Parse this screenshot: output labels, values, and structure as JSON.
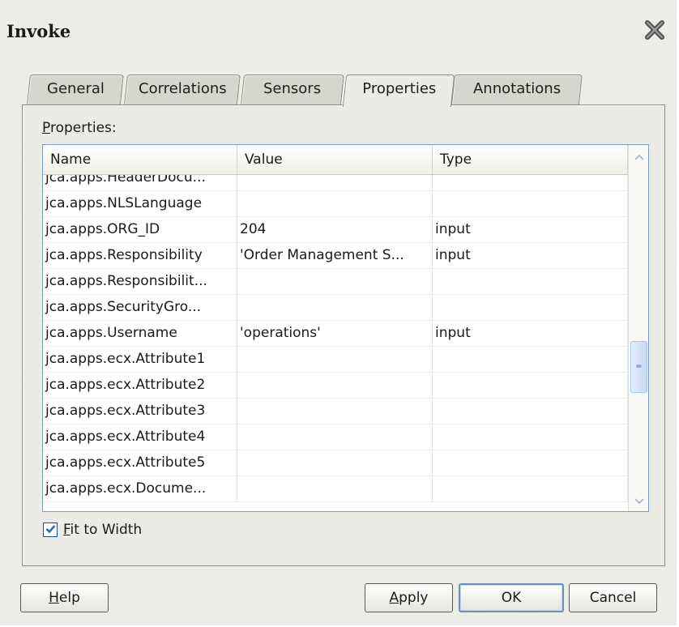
{
  "dialog": {
    "title": "Invoke",
    "close_icon": "close-x-icon"
  },
  "tabs": [
    {
      "label": "General",
      "active": false
    },
    {
      "label": "Correlations",
      "active": false
    },
    {
      "label": "Sensors",
      "active": false
    },
    {
      "label": "Properties",
      "active": true
    },
    {
      "label": "Annotations",
      "active": false
    }
  ],
  "properties": {
    "label_mnemonic": "P",
    "label_rest": "roperties:",
    "columns": [
      "Name",
      "Value",
      "Type"
    ],
    "rows": [
      {
        "name": "jca.apps.HeaderDocu...",
        "value": "",
        "type": ""
      },
      {
        "name": "jca.apps.NLSLanguage",
        "value": "",
        "type": ""
      },
      {
        "name": "jca.apps.ORG_ID",
        "value": "204",
        "type": "input"
      },
      {
        "name": "jca.apps.Responsibility",
        "value": "'Order Management S...",
        "type": "input"
      },
      {
        "name": "jca.apps.Responsibilit...",
        "value": "",
        "type": ""
      },
      {
        "name": "jca.apps.SecurityGro...",
        "value": "",
        "type": ""
      },
      {
        "name": "jca.apps.Username",
        "value": "'operations'",
        "type": "input"
      },
      {
        "name": "jca.apps.ecx.Attribute1",
        "value": "",
        "type": ""
      },
      {
        "name": "jca.apps.ecx.Attribute2",
        "value": "",
        "type": ""
      },
      {
        "name": "jca.apps.ecx.Attribute3",
        "value": "",
        "type": ""
      },
      {
        "name": "jca.apps.ecx.Attribute4",
        "value": "",
        "type": ""
      },
      {
        "name": "jca.apps.ecx.Attribute5",
        "value": "",
        "type": ""
      },
      {
        "name": "jca.apps.ecx.Docume...",
        "value": "",
        "type": ""
      }
    ]
  },
  "fit_to_width": {
    "checked": true,
    "label_mnemonic": "F",
    "label_rest": "it to Width"
  },
  "buttons": {
    "help": {
      "mnemonic": "H",
      "rest": "elp"
    },
    "apply": {
      "mnemonic": "A",
      "rest": "pply"
    },
    "ok": {
      "label": "OK"
    },
    "cancel": {
      "label": "Cancel"
    }
  },
  "colors": {
    "dialog_bg": "#ecebe6",
    "tab_bg": "#d7d6ce",
    "checkbox_check": "#1f6fc8",
    "default_button_border": "#6f8fbd"
  }
}
